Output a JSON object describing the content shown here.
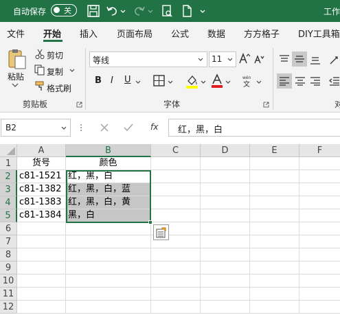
{
  "titlebar": {
    "autosave_label": "自动保存",
    "toggle_state": "关",
    "title": "工作"
  },
  "tabs": [
    "文件",
    "开始",
    "插入",
    "页面布局",
    "公式",
    "数据",
    "方方格子",
    "DIY工具箱"
  ],
  "ribbon": {
    "clipboard": {
      "paste": "粘贴",
      "cut": "剪切",
      "copy": "复制",
      "format_painter": "格式刷",
      "group_label": "剪贴板"
    },
    "font": {
      "font_name": "等线",
      "font_size": "11",
      "bold": "B",
      "italic": "I",
      "underline": "U",
      "group_label": "字体",
      "font_color": "#e02020",
      "highlight_color": "#ffff00"
    }
  },
  "formula_bar": {
    "name_box": "B2",
    "fx": "fx",
    "content": "红，黑，白"
  },
  "sheet": {
    "columns": [
      "A",
      "B",
      "C",
      "D",
      "E",
      "F"
    ],
    "rows": [
      "1",
      "2",
      "3",
      "4",
      "5",
      "6",
      "7",
      "8",
      "9",
      "10",
      "11",
      "12"
    ],
    "cells": {
      "A1": "货号",
      "B1": "颜色",
      "A2": "c81-1521",
      "B2": "红，黑，白",
      "A3": "c81-1382",
      "B3": "红，黑，白，蓝",
      "A4": "c81-1383",
      "B4": "红，黑，白，黄",
      "A5": "c81-1384",
      "B5": "黑，白"
    },
    "selection": "B2:B5"
  },
  "colors": {
    "accent": "#217346"
  }
}
